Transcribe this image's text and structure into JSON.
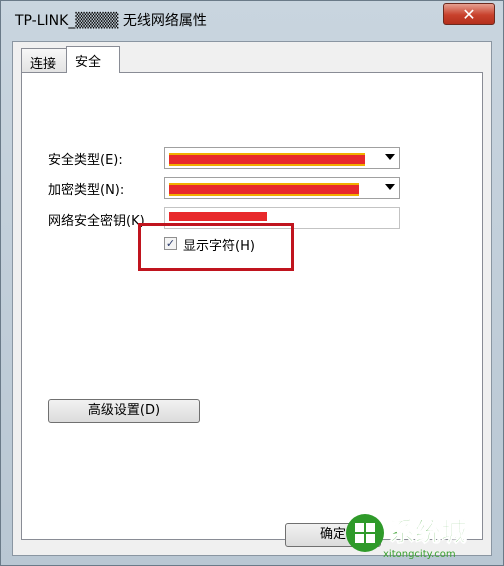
{
  "window": {
    "title": "TP-LINK_▒▒▒▒ 无线网络属性",
    "close_glyph": "✕"
  },
  "tabs": [
    {
      "label": "连接",
      "active": false
    },
    {
      "label": "安全",
      "active": true
    }
  ],
  "security": {
    "type_label": "安全类型(E):",
    "encryption_label": "加密类型(N):",
    "key_label": "网络安全密钥(K)",
    "show_chars_label": "显示字符(H)",
    "show_chars_checked": true,
    "check_glyph": "✓"
  },
  "buttons": {
    "advanced": "高级设置(D)",
    "ok": "确定"
  },
  "watermark": {
    "text": "系统城",
    "url": "xitongcity.com"
  },
  "colors": {
    "highlight": "#c0141e",
    "redaction": "#e8292b"
  }
}
